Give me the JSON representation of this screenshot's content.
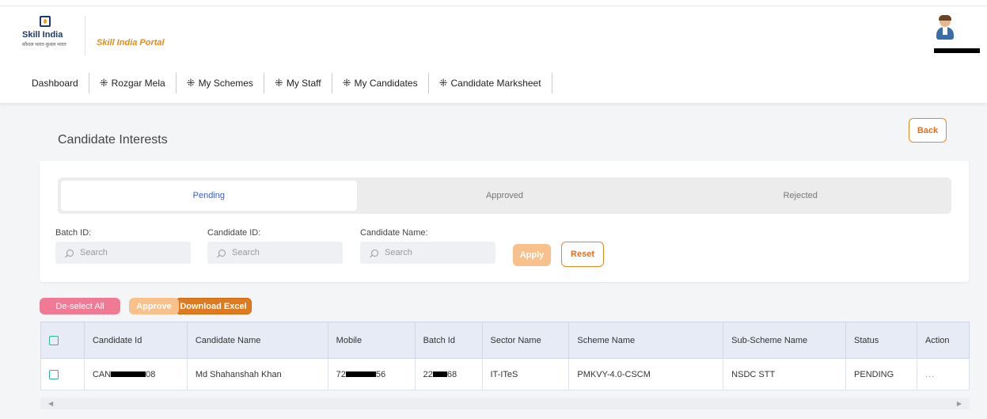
{
  "header": {
    "logo_name": "Skill India",
    "logo_tagline": "कौशल भारत-कुशल भारत",
    "portal_title": "Skill India Portal"
  },
  "nav": [
    {
      "label": "Dashboard",
      "icon": "network-icon",
      "has_icon": false
    },
    {
      "label": "Rozgar Mela",
      "icon": "network-icon",
      "has_icon": true
    },
    {
      "label": "My Schemes",
      "icon": "network-icon",
      "has_icon": true
    },
    {
      "label": "My Staff",
      "icon": "network-icon",
      "has_icon": true
    },
    {
      "label": "My Candidates",
      "icon": "network-icon",
      "has_icon": true
    },
    {
      "label": "Candidate Marksheet",
      "icon": "network-icon",
      "has_icon": true
    }
  ],
  "page": {
    "title": "Candidate Interests",
    "back_label": "Back"
  },
  "tabs": [
    {
      "label": "Pending",
      "active": true
    },
    {
      "label": "Approved",
      "active": false
    },
    {
      "label": "Rejected",
      "active": false
    }
  ],
  "filters": {
    "batch_label": "Batch ID:",
    "candidate_id_label": "Candidate ID:",
    "candidate_name_label": "Candidate Name:",
    "search_placeholder": "Search",
    "apply_label": "Apply",
    "reset_label": "Reset"
  },
  "actions": {
    "deselect_label": "De-select All",
    "approve_label": "Approve",
    "download_label": "Download Excel"
  },
  "table": {
    "columns": [
      "Candidate Id",
      "Candidate Name",
      "Mobile",
      "Batch Id",
      "Sector Name",
      "Scheme Name",
      "Sub-Scheme Name",
      "Status",
      "Action"
    ],
    "rows": [
      {
        "candidate_id_prefix": "CAN",
        "candidate_id_suffix": "08",
        "candidate_name": "Md Shahanshah Khan",
        "mobile_prefix": "72",
        "mobile_suffix": "56",
        "batch_prefix": "22",
        "batch_suffix": "68",
        "sector": "IT-ITeS",
        "scheme": "PMKVY-4.0-CSCM",
        "sub_scheme": "NSDC STT",
        "status": "PENDING",
        "action": "..."
      }
    ]
  },
  "colors": {
    "accent": "#e88a1a",
    "active_tab_text": "#3b5cc4",
    "deselect": "#f07a94",
    "download": "#e07a1e",
    "checkbox": "#2cb69a"
  }
}
